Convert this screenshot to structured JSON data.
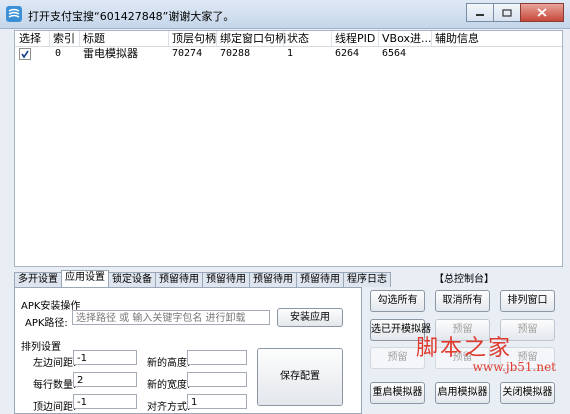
{
  "window": {
    "title": "打开支付宝搜“601427848”谢谢大家了。"
  },
  "grid": {
    "columns": [
      "选择",
      "索引",
      "标题",
      "顶层句柄",
      "绑定窗口句柄",
      "状态",
      "线程PID",
      "VBox进...",
      "辅助信息"
    ],
    "rows": [
      {
        "checked": true,
        "index": "0",
        "title": "雷电模拟器",
        "top_handle": "70274",
        "bind_handle": "70288",
        "status": "1",
        "thread_pid": "6264",
        "vbox": "6564",
        "aux": ""
      }
    ]
  },
  "tabs": [
    "多开设置",
    "应用设置",
    "锁定设备",
    "预留待用",
    "预留待用",
    "预留待用",
    "预留待用",
    "程序日志"
  ],
  "active_tab_index": 1,
  "apk": {
    "group_label": "APK安装操作",
    "path_label": "APK路径:",
    "path_placeholder": "选择路径 或 输入关键字包名 进行卸载",
    "install_button": "安装应用"
  },
  "arrange": {
    "group_label": "排列设置",
    "left_margin_label": "左边间距:",
    "left_margin_value": "-1",
    "per_row_label": "每行数量:",
    "per_row_value": "2",
    "top_margin_label": "顶边间距:",
    "top_margin_value": "-1",
    "new_height_label": "新的高度:",
    "new_height_value": "",
    "new_width_label": "新的宽度:",
    "new_width_value": "",
    "align_label": "对齐方式:",
    "align_value": "1",
    "save_button": "保存配置"
  },
  "control": {
    "title": "【总控制台】",
    "buttons": [
      {
        "label": "勾选所有",
        "disabled": false,
        "ghost": false
      },
      {
        "label": "取消所有",
        "disabled": false,
        "ghost": false
      },
      {
        "label": "排列窗口",
        "disabled": false,
        "ghost": false
      },
      {
        "label": "选已开模拟器",
        "disabled": false,
        "ghost": false
      },
      {
        "label": "预留",
        "disabled": true,
        "ghost": false
      },
      {
        "label": "预留",
        "disabled": true,
        "ghost": false
      },
      {
        "label": "预留",
        "disabled": true,
        "ghost": true
      },
      {
        "label": "预留",
        "disabled": true,
        "ghost": true
      },
      {
        "label": "预留",
        "disabled": true,
        "ghost": true
      },
      {
        "label": "重启模拟器",
        "disabled": false,
        "ghost": false
      },
      {
        "label": "启用模拟器",
        "disabled": false,
        "ghost": false
      },
      {
        "label": "关闭模拟器",
        "disabled": false,
        "ghost": false
      }
    ]
  },
  "watermark": {
    "text": "脚本之家",
    "url": "www.jb51.net"
  }
}
